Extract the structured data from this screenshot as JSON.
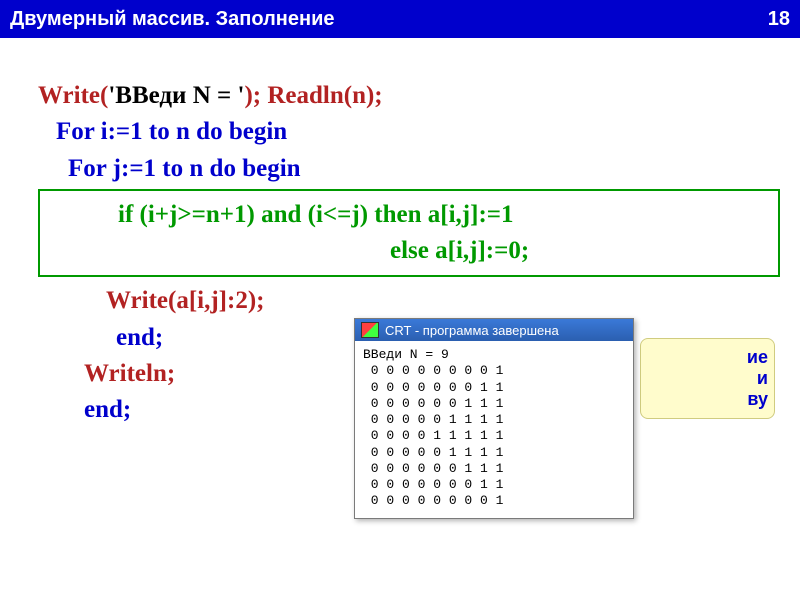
{
  "header": {
    "title": "Двумерный массив. Заполнение",
    "page_number": "18"
  },
  "code": {
    "l1a": "Write(",
    "l1b": "'ВВеди N = '",
    "l1c": "); Readln(n);",
    "l2": "For i:=1 to n do begin",
    "l3": "For j:=1 to n do begin",
    "l4": "if (i+j>=n+1) and (i<=j) then a[i,j]:=1",
    "l5": "else a[i,j]:=0;",
    "l6": "Write(a[i,j]:2);",
    "l7": "end;",
    "l8": "Writeln;",
    "l9": "end;"
  },
  "crt": {
    "title": "CRT - программа завершена",
    "prompt": "ВВеди N = 9",
    "rows": [
      " 0 0 0 0 0 0 0 0 1",
      " 0 0 0 0 0 0 0 1 1",
      " 0 0 0 0 0 0 1 1 1",
      " 0 0 0 0 0 1 1 1 1",
      " 0 0 0 0 1 1 1 1 1",
      " 0 0 0 0 0 1 1 1 1",
      " 0 0 0 0 0 0 1 1 1",
      " 0 0 0 0 0 0 0 1 1",
      " 0 0 0 0 0 0 0 0 1"
    ]
  },
  "callout": {
    "line1": "ие",
    "line2": "и",
    "line3": "ву"
  }
}
